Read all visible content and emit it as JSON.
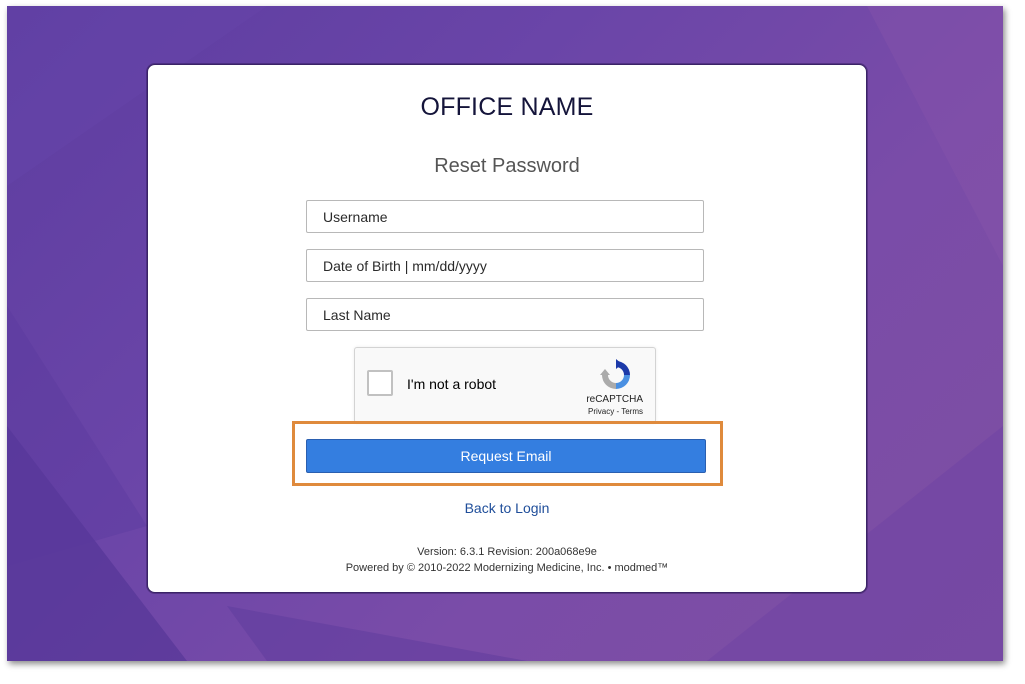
{
  "header": {
    "office_name": "OFFICE NAME",
    "title": "Reset Password"
  },
  "form": {
    "username_placeholder": "Username",
    "dob_placeholder": "Date of Birth | mm/dd/yyyy",
    "last_name_placeholder": "Last Name",
    "username_value": "",
    "dob_value": "",
    "last_name_value": ""
  },
  "captcha": {
    "label": "I'm not a robot",
    "brand": "reCAPTCHA",
    "links": "Privacy - Terms",
    "checked": false
  },
  "actions": {
    "request_email_label": "Request Email",
    "back_to_login_label": "Back to Login"
  },
  "footer": {
    "version": "Version: 6.3.1 Revision: 200a068e9e",
    "powered_by": "Powered by © 2010-2022 Modernizing Medicine, Inc. • modmed™"
  },
  "colors": {
    "background_start": "#5d3da0",
    "background_end": "#7e4fa2",
    "button": "#347ee0",
    "highlight": "#df8a3c",
    "link": "#1f4e9a"
  }
}
